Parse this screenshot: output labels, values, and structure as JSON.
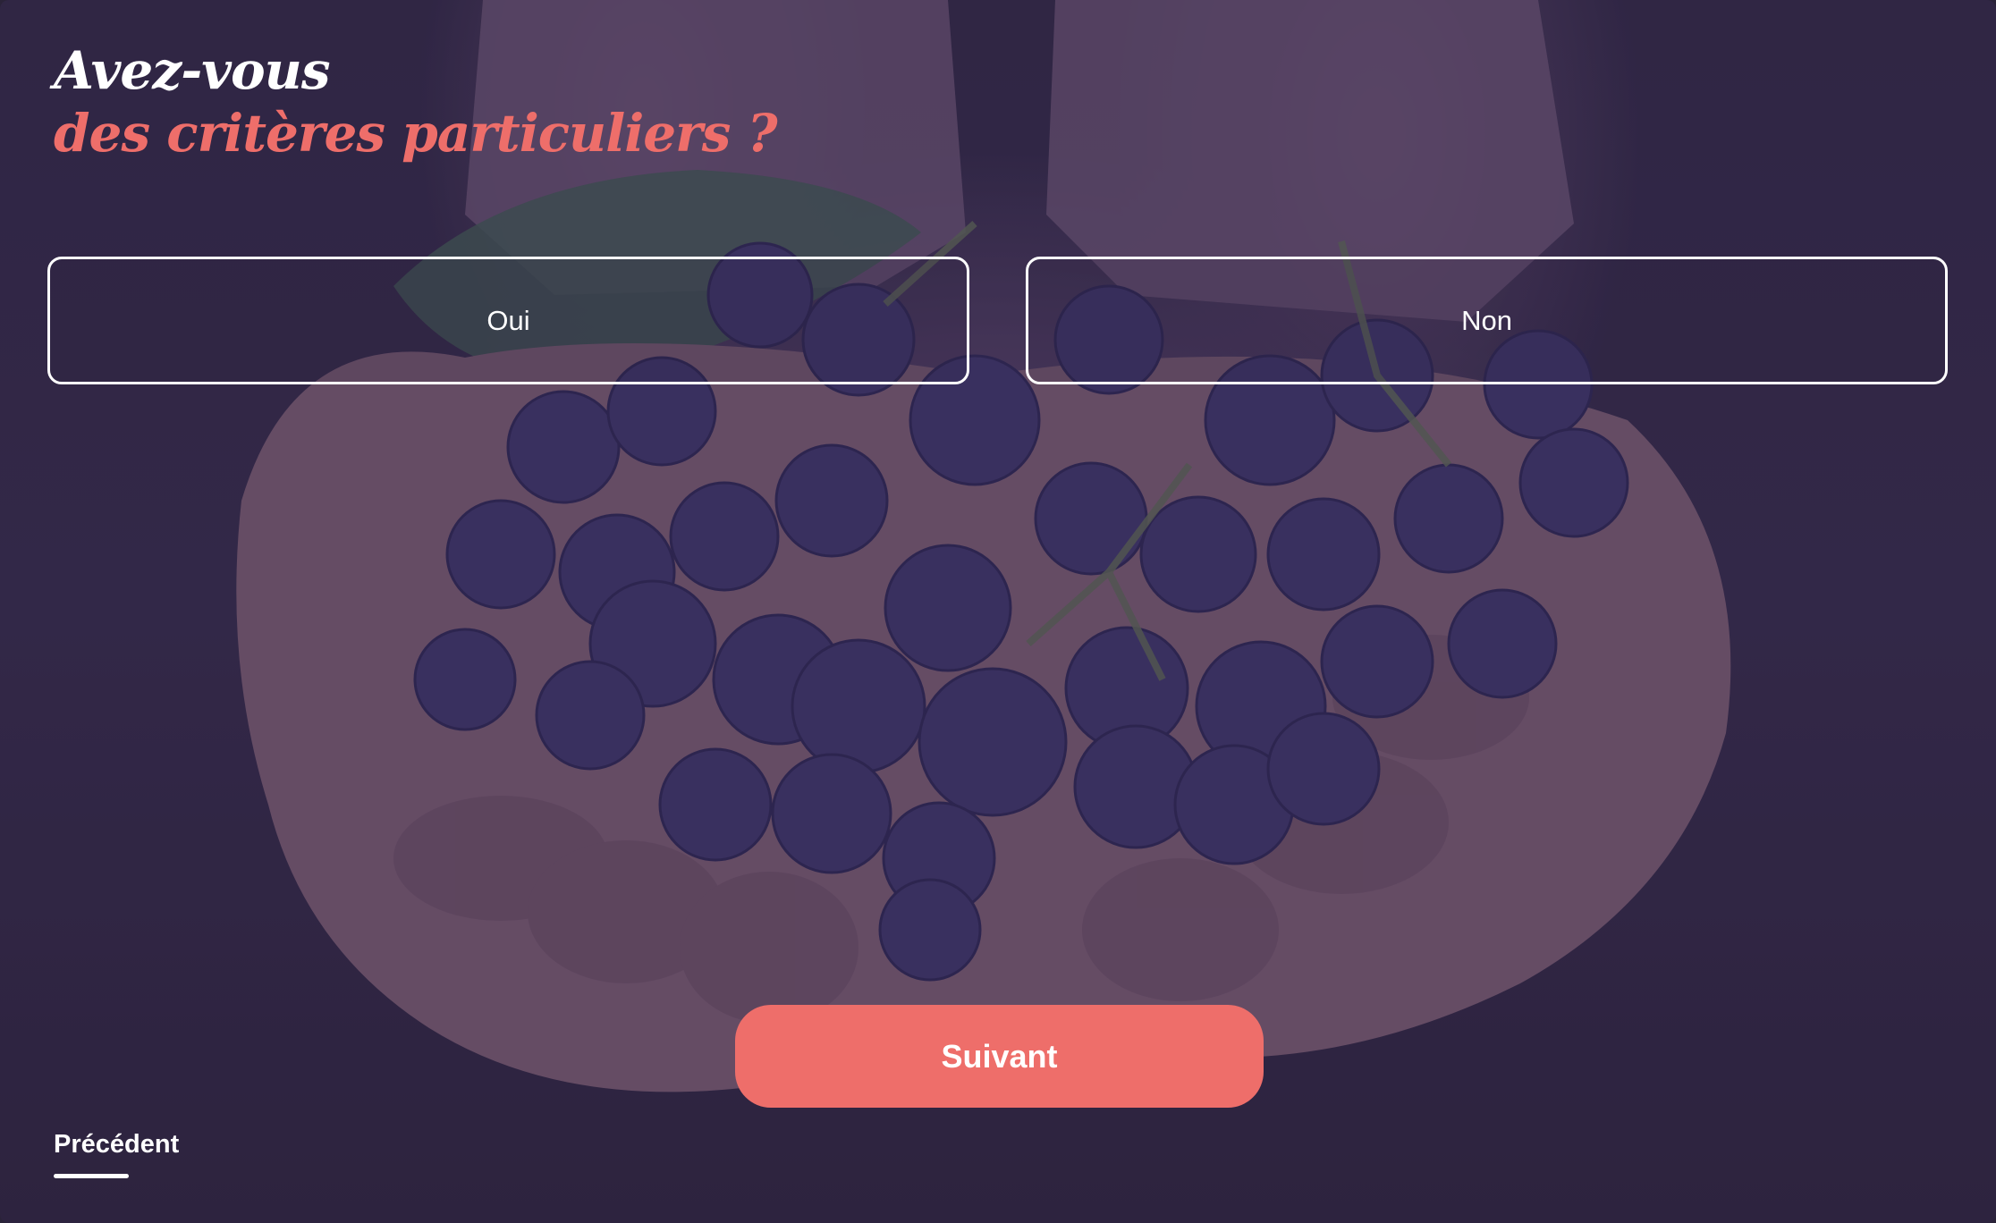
{
  "question": {
    "line1": "Avez-vous",
    "line2": "des critères particuliers ?"
  },
  "options": [
    {
      "label": "Oui"
    },
    {
      "label": "Non"
    }
  ],
  "actions": {
    "next_label": "Suivant",
    "previous_label": "Précédent"
  },
  "colors": {
    "accent": "#ee6e6a",
    "text": "#ffffff",
    "overlay": "#342350"
  },
  "background": {
    "icon": "grapes-in-hands-photo"
  }
}
